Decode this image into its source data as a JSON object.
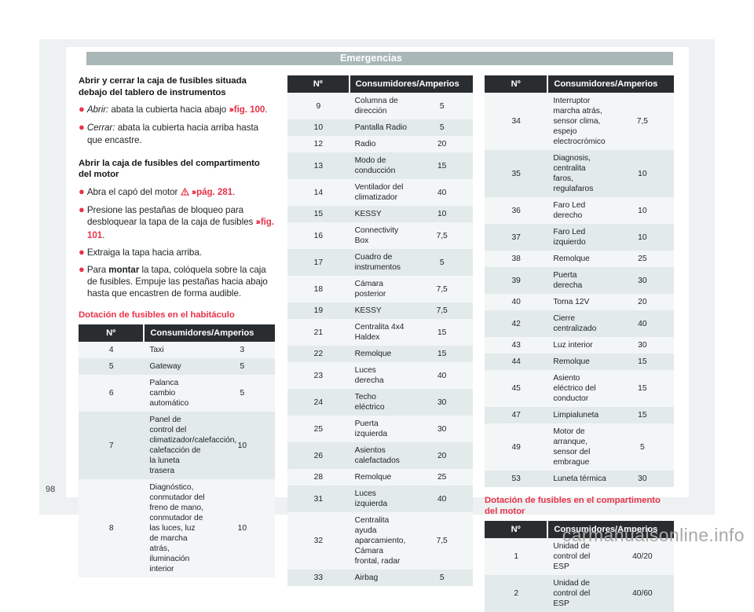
{
  "document": {
    "running_head": "Emergencias",
    "page_number": "98",
    "watermark": "carmanualsonline.info"
  },
  "content": {
    "section1": {
      "heading": "Abrir y cerrar la caja de fusibles situada debajo del tablero de instrumentos",
      "bullet1_lead": "Abrir:",
      "bullet1_text": "abata la cubierta hacia abajo",
      "bullet1_ref": "fig. 100",
      "bullet2_lead": "Cerrar:",
      "bullet2_text": "abata la cubierta hacia arriba hasta que encastre."
    },
    "section2": {
      "heading": "Abrir la caja de fusibles del compartimento del motor",
      "bullet1_text": "Abra el capó del motor",
      "bullet1_ref": "pág. 281",
      "bullet2_text": "Presione las pestañas de bloqueo para desbloquear la tapa de la caja de fusibles",
      "bullet2_ref": "fig. 101",
      "bullet3_text": "Extraiga la tapa hacia arriba.",
      "bullet4_pre": "Para",
      "bullet4_bold": "montar",
      "bullet4_post": "la tapa, colóquela sobre la caja de fusibles. Empuje las pestañas hacia abajo hasta que encastren de forma audible."
    },
    "heading_habitaculo": "Dotación de fusibles en el habitáculo",
    "heading_motor": "Dotación de fusibles en el compartimento del motor"
  },
  "table_headers": {
    "num": "Nº",
    "desc": "Consumidores/Amperios"
  },
  "tables": {
    "habitaculo_col1": [
      {
        "num": "4",
        "desc": "Taxi",
        "amp": "3"
      },
      {
        "num": "5",
        "desc": "Gateway",
        "amp": "5"
      },
      {
        "num": "6",
        "desc": "Palanca cambio automático",
        "amp": "5"
      },
      {
        "num": "7",
        "desc": "Panel de control del climatizador/calefacción, calefacción de la luneta trasera",
        "amp": "10"
      },
      {
        "num": "8",
        "desc": "Diagnóstico, conmutador del freno de mano, conmutador de las luces, luz de marcha atrás, iluminación interior",
        "amp": "10"
      }
    ],
    "habitaculo_col2": [
      {
        "num": "9",
        "desc": "Columna de dirección",
        "amp": "5"
      },
      {
        "num": "10",
        "desc": "Pantalla Radio",
        "amp": "5"
      },
      {
        "num": "12",
        "desc": "Radio",
        "amp": "20"
      },
      {
        "num": "13",
        "desc": "Modo de conducción",
        "amp": "15"
      },
      {
        "num": "14",
        "desc": "Ventilador del climatizador",
        "amp": "40"
      },
      {
        "num": "15",
        "desc": "KESSY",
        "amp": "10"
      },
      {
        "num": "16",
        "desc": "Connectivity Box",
        "amp": "7,5"
      },
      {
        "num": "17",
        "desc": "Cuadro de instrumentos",
        "amp": "5"
      },
      {
        "num": "18",
        "desc": "Cámara posterior",
        "amp": "7,5"
      },
      {
        "num": "19",
        "desc": "KESSY",
        "amp": "7,5"
      },
      {
        "num": "21",
        "desc": "Centralita 4x4 Haldex",
        "amp": "15"
      },
      {
        "num": "22",
        "desc": "Remolque",
        "amp": "15"
      },
      {
        "num": "23",
        "desc": "Luces derecha",
        "amp": "40"
      },
      {
        "num": "24",
        "desc": "Techo eléctrico",
        "amp": "30"
      },
      {
        "num": "25",
        "desc": "Puerta izquierda",
        "amp": "30"
      },
      {
        "num": "26",
        "desc": "Asientos calefactados",
        "amp": "20"
      },
      {
        "num": "28",
        "desc": "Remolque",
        "amp": "25"
      },
      {
        "num": "31",
        "desc": "Luces izquierda",
        "amp": "40"
      },
      {
        "num": "32",
        "desc": "Centralita ayuda aparcamiento, Cámara frontal, radar",
        "amp": "7,5"
      },
      {
        "num": "33",
        "desc": "Airbag",
        "amp": "5"
      }
    ],
    "habitaculo_col3": [
      {
        "num": "34",
        "desc": "Interruptor marcha atrás, sensor clima, espejo electrocrómico",
        "amp": "7,5"
      },
      {
        "num": "35",
        "desc": "Diagnosis, centralita faros, regulafaros",
        "amp": "10"
      },
      {
        "num": "36",
        "desc": "Faro Led derecho",
        "amp": "10"
      },
      {
        "num": "37",
        "desc": "Faro Led izquierdo",
        "amp": "10"
      },
      {
        "num": "38",
        "desc": "Remolque",
        "amp": "25"
      },
      {
        "num": "39",
        "desc": "Puerta derecha",
        "amp": "30"
      },
      {
        "num": "40",
        "desc": "Toma 12V",
        "amp": "20"
      },
      {
        "num": "42",
        "desc": "Cierre centralizado",
        "amp": "40"
      },
      {
        "num": "43",
        "desc": "Luz interior",
        "amp": "30"
      },
      {
        "num": "44",
        "desc": "Remolque",
        "amp": "15"
      },
      {
        "num": "45",
        "desc": "Asiento eléctrico del conductor",
        "amp": "15"
      },
      {
        "num": "47",
        "desc": "Limpialuneta",
        "amp": "15"
      },
      {
        "num": "49",
        "desc": "Motor de arranque, sensor del embrague",
        "amp": "5"
      },
      {
        "num": "53",
        "desc": "Luneta térmica",
        "amp": "30"
      }
    ],
    "motor": [
      {
        "num": "1",
        "desc": "Unidad de control del ESP",
        "amp": "40/20"
      },
      {
        "num": "2",
        "desc": "Unidad de control del ESP",
        "amp": "40/60"
      }
    ]
  },
  "colors": {
    "accent_red": "#e8334a",
    "header_bar": "#a9b7b7",
    "table_header": "#2a2d2f",
    "row_light": "#f3f6f6",
    "row_dark": "#e3eaea"
  }
}
